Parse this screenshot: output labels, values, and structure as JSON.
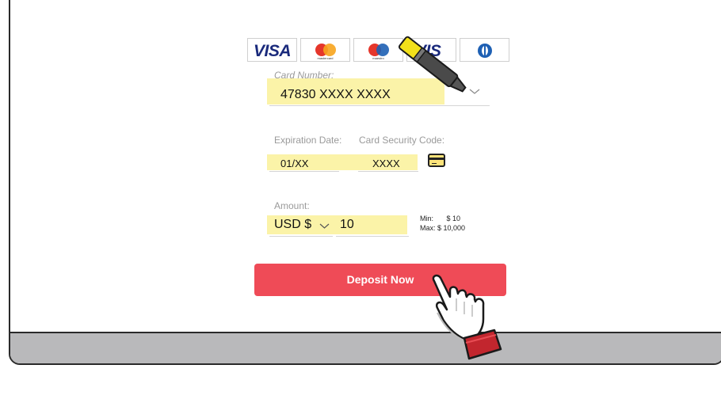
{
  "card_logos": [
    {
      "brand": "VISA",
      "icon": "visa-logo"
    },
    {
      "caption": "mastercard",
      "icon": "mastercard-logo",
      "colors": [
        "#e5362b",
        "#f7a41d"
      ]
    },
    {
      "caption": "maestro",
      "icon": "maestro-logo",
      "colors": [
        "#1e60b4",
        "#e5362b"
      ]
    },
    {
      "brand": "VIS",
      "icon": "visa-logo-partial"
    },
    {
      "icon": "diners-club-logo"
    }
  ],
  "card_number": {
    "label": "Card Number:",
    "value": "47830 XXXX XXXX",
    "icon": "chevron-down-icon"
  },
  "expiration": {
    "label": "Expiration Date:",
    "value": "01/XX"
  },
  "security_code": {
    "label": "Card Security Code:",
    "value": "XXXX",
    "icon": "credit-card-icon"
  },
  "amount": {
    "label": "Amount:",
    "currency": "USD $",
    "value": "10",
    "min_label": "Min:",
    "min_value": "$ 10",
    "max_text": "Max: $ 10,000"
  },
  "deposit_button": {
    "label": "Deposit Now"
  },
  "overlays": {
    "pen_icon": "highlighter-pen-icon",
    "hand_icon": "pointing-hand-icon"
  },
  "colors": {
    "accent": "#ef4b57",
    "highlight": "#fbf3a8",
    "visa_blue": "#1a2a7c"
  }
}
